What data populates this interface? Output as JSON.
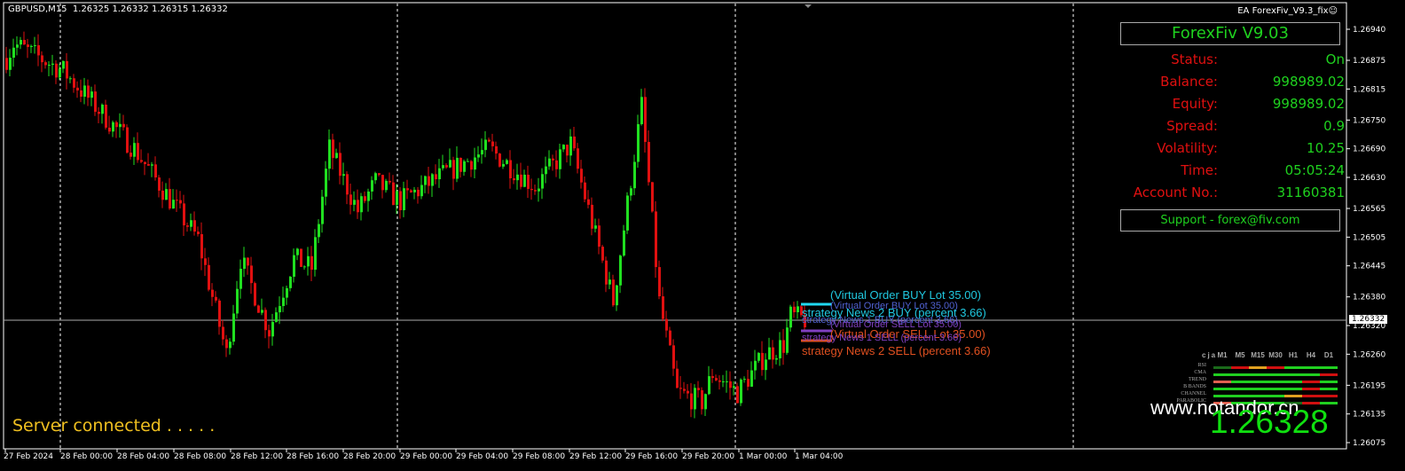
{
  "header": {
    "symbol": "GBPUSD,M15",
    "ohlc": "1.26325 1.26332 1.26315 1.26332",
    "ea_name": "EA ForexFiv_V9.3_fix",
    "ea_icon": "smiley-icon"
  },
  "panel": {
    "title": "ForexFiv  V9.03",
    "rows": [
      {
        "label": "Status:",
        "value": "On"
      },
      {
        "label": "Balance:",
        "value": "998989.02"
      },
      {
        "label": "Equity:",
        "value": "998989.02"
      },
      {
        "label": "Spread:",
        "value": "0.9"
      },
      {
        "label": "Volatility:",
        "value": "10.25"
      },
      {
        "label": "Time:",
        "value": "05:05:24"
      },
      {
        "label": "Account No.:",
        "value": "31160381"
      }
    ],
    "support": "Support - forex@fiv.com"
  },
  "signals": [
    {
      "text": "(Virtual Order BUY Lot 35.00)",
      "color": "#20c8e0"
    },
    {
      "text": "(Virtual Order BUY Lot 35.00)",
      "color": "#5060d0"
    },
    {
      "text": "strategy News 2 BUY (percent 3.66)",
      "color": "#20c8e0"
    },
    {
      "text": "strategy News 1 BUY (percent 3.66)",
      "color": "#5060d0"
    },
    {
      "text": "(Virtual Order SELL Lot 35.00)",
      "color": "#8040c0"
    },
    {
      "text": "(Virtual Order SELL Lot 35.00)",
      "color": "#e05020"
    },
    {
      "text": "strategy News 1 SELL (percent 3.66)",
      "color": "#8040c0"
    },
    {
      "text": "strategy News 2 SELL (percent 3.66)",
      "color": "#e05020"
    }
  ],
  "status": {
    "server": "Server connected . . . . .",
    "website": "www.notandor.cn",
    "big_price": "1.26328"
  },
  "matrix": {
    "corner": "cja",
    "timeframes": [
      "M1",
      "M5",
      "M15",
      "M30",
      "H1",
      "H4",
      "D1"
    ],
    "rows": [
      {
        "name": "RSI",
        "cells": [
          "#1a6a1a",
          "#d01010",
          "#e0a020",
          "#d01010",
          "#20d020",
          "#20d020",
          "#20d020"
        ]
      },
      {
        "name": "CMA",
        "cells": [
          "#20d020",
          "#20d020",
          "#20d020",
          "#20d020",
          "#20d020",
          "#20d020",
          "#d01010"
        ]
      },
      {
        "name": "TREND",
        "cells": [
          "#e06050",
          "#20d020",
          "#20d020",
          "#20d020",
          "#20d020",
          "#d01010",
          "#20d020"
        ]
      },
      {
        "name": "B BANDS",
        "cells": [
          "#20d020",
          "#20d020",
          "#20d020",
          "#20d020",
          "#20d020",
          "#d01010",
          "#20d020"
        ]
      },
      {
        "name": "CHANNEL",
        "cells": [
          "#20d020",
          "#20d020",
          "#20d020",
          "#20d020",
          "#e0a020",
          "#d01010",
          "#d01010"
        ]
      },
      {
        "name": "PARABOLIC",
        "cells": [
          "#e06050",
          "#20d020",
          "#20d020",
          "#20d020",
          "#1a6a1a",
          "#d01010",
          "#20d020"
        ]
      }
    ]
  },
  "chart_data": {
    "type": "candlestick",
    "symbol": "GBPUSD",
    "timeframe": "M15",
    "current_price": "1.26332",
    "y_ticks": [
      "1.26940",
      "1.26875",
      "1.26815",
      "1.26750",
      "1.26690",
      "1.26630",
      "1.26565",
      "1.26505",
      "1.26445",
      "1.26380",
      "1.26320",
      "1.26260",
      "1.26195",
      "1.26135",
      "1.26075"
    ],
    "x_ticks": [
      "27 Feb 2024",
      "28 Feb 00:00",
      "28 Feb 04:00",
      "28 Feb 08:00",
      "28 Feb 12:00",
      "28 Feb 16:00",
      "28 Feb 20:00",
      "29 Feb 00:00",
      "29 Feb 04:00",
      "29 Feb 08:00",
      "29 Feb 12:00",
      "29 Feb 16:00",
      "29 Feb 20:00",
      "1 Mar 00:00",
      "1 Mar 04:00"
    ],
    "ylim": [
      1.26075,
      1.2694
    ],
    "close_path": [
      [
        0,
        1.2688
      ],
      [
        2,
        1.2691
      ],
      [
        16,
        1.26853
      ],
      [
        36,
        1.2669
      ],
      [
        54,
        1.265
      ],
      [
        62,
        1.2626
      ],
      [
        66,
        1.2646
      ],
      [
        74,
        1.2631
      ],
      [
        81,
        1.2646
      ],
      [
        86,
        1.2644
      ],
      [
        91,
        1.2669
      ],
      [
        99,
        1.2656
      ],
      [
        104,
        1.2662
      ],
      [
        111,
        1.2658
      ],
      [
        124,
        1.2664
      ],
      [
        136,
        1.2669
      ],
      [
        149,
        1.2661
      ],
      [
        159,
        1.267
      ],
      [
        171,
        1.2637
      ],
      [
        179,
        1.2678
      ],
      [
        184,
        1.2637
      ],
      [
        189,
        1.2618
      ],
      [
        196,
        1.2616
      ],
      [
        199,
        1.2622
      ],
      [
        206,
        1.2618
      ],
      [
        214,
        1.2626
      ],
      [
        219,
        1.2628
      ],
      [
        221,
        1.2634
      ],
      [
        225,
        1.26332
      ]
    ]
  }
}
